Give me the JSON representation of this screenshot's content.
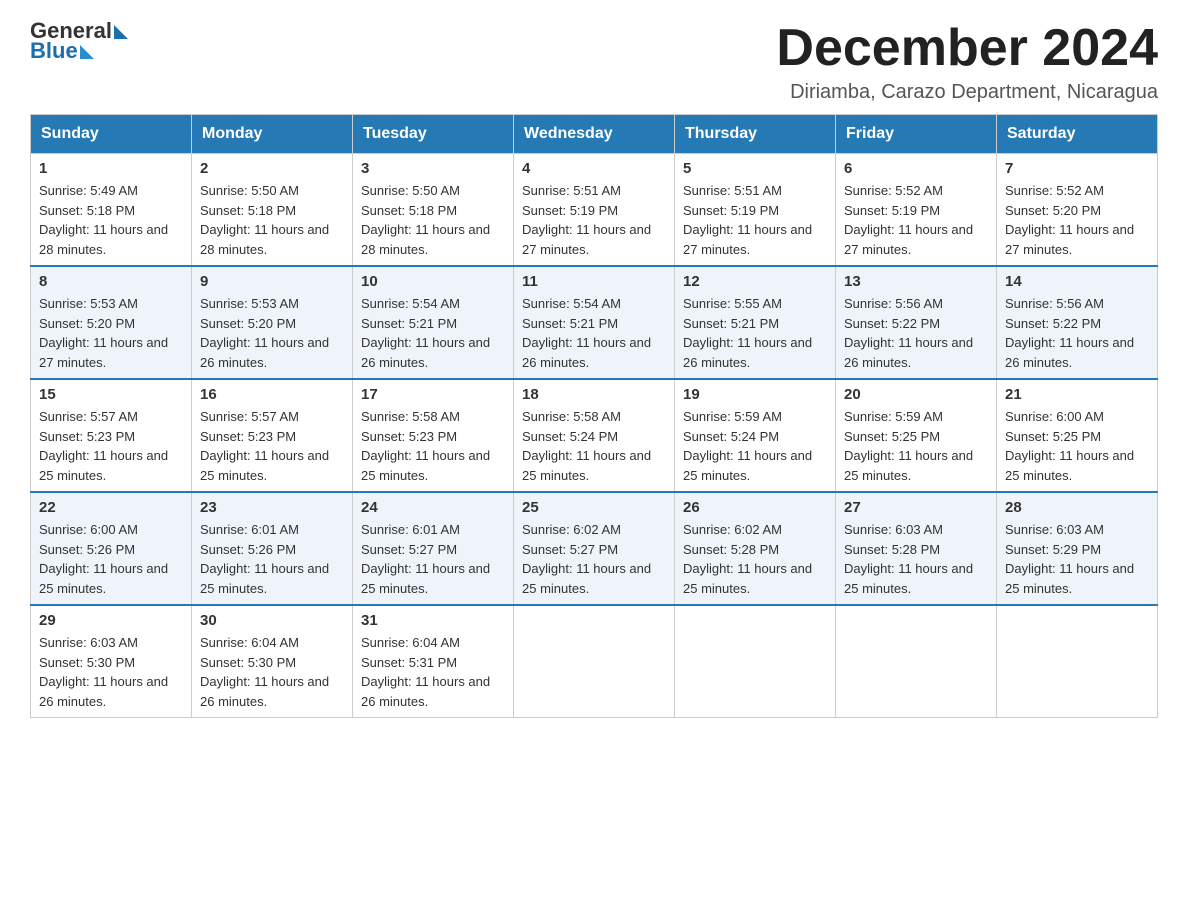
{
  "logo": {
    "text_general": "General",
    "text_blue": "Blue"
  },
  "title": "December 2024",
  "location": "Diriamba, Carazo Department, Nicaragua",
  "days_of_week": [
    "Sunday",
    "Monday",
    "Tuesday",
    "Wednesday",
    "Thursday",
    "Friday",
    "Saturday"
  ],
  "weeks": [
    [
      {
        "day": "1",
        "sunrise": "Sunrise: 5:49 AM",
        "sunset": "Sunset: 5:18 PM",
        "daylight": "Daylight: 11 hours and 28 minutes."
      },
      {
        "day": "2",
        "sunrise": "Sunrise: 5:50 AM",
        "sunset": "Sunset: 5:18 PM",
        "daylight": "Daylight: 11 hours and 28 minutes."
      },
      {
        "day": "3",
        "sunrise": "Sunrise: 5:50 AM",
        "sunset": "Sunset: 5:18 PM",
        "daylight": "Daylight: 11 hours and 28 minutes."
      },
      {
        "day": "4",
        "sunrise": "Sunrise: 5:51 AM",
        "sunset": "Sunset: 5:19 PM",
        "daylight": "Daylight: 11 hours and 27 minutes."
      },
      {
        "day": "5",
        "sunrise": "Sunrise: 5:51 AM",
        "sunset": "Sunset: 5:19 PM",
        "daylight": "Daylight: 11 hours and 27 minutes."
      },
      {
        "day": "6",
        "sunrise": "Sunrise: 5:52 AM",
        "sunset": "Sunset: 5:19 PM",
        "daylight": "Daylight: 11 hours and 27 minutes."
      },
      {
        "day": "7",
        "sunrise": "Sunrise: 5:52 AM",
        "sunset": "Sunset: 5:20 PM",
        "daylight": "Daylight: 11 hours and 27 minutes."
      }
    ],
    [
      {
        "day": "8",
        "sunrise": "Sunrise: 5:53 AM",
        "sunset": "Sunset: 5:20 PM",
        "daylight": "Daylight: 11 hours and 27 minutes."
      },
      {
        "day": "9",
        "sunrise": "Sunrise: 5:53 AM",
        "sunset": "Sunset: 5:20 PM",
        "daylight": "Daylight: 11 hours and 26 minutes."
      },
      {
        "day": "10",
        "sunrise": "Sunrise: 5:54 AM",
        "sunset": "Sunset: 5:21 PM",
        "daylight": "Daylight: 11 hours and 26 minutes."
      },
      {
        "day": "11",
        "sunrise": "Sunrise: 5:54 AM",
        "sunset": "Sunset: 5:21 PM",
        "daylight": "Daylight: 11 hours and 26 minutes."
      },
      {
        "day": "12",
        "sunrise": "Sunrise: 5:55 AM",
        "sunset": "Sunset: 5:21 PM",
        "daylight": "Daylight: 11 hours and 26 minutes."
      },
      {
        "day": "13",
        "sunrise": "Sunrise: 5:56 AM",
        "sunset": "Sunset: 5:22 PM",
        "daylight": "Daylight: 11 hours and 26 minutes."
      },
      {
        "day": "14",
        "sunrise": "Sunrise: 5:56 AM",
        "sunset": "Sunset: 5:22 PM",
        "daylight": "Daylight: 11 hours and 26 minutes."
      }
    ],
    [
      {
        "day": "15",
        "sunrise": "Sunrise: 5:57 AM",
        "sunset": "Sunset: 5:23 PM",
        "daylight": "Daylight: 11 hours and 25 minutes."
      },
      {
        "day": "16",
        "sunrise": "Sunrise: 5:57 AM",
        "sunset": "Sunset: 5:23 PM",
        "daylight": "Daylight: 11 hours and 25 minutes."
      },
      {
        "day": "17",
        "sunrise": "Sunrise: 5:58 AM",
        "sunset": "Sunset: 5:23 PM",
        "daylight": "Daylight: 11 hours and 25 minutes."
      },
      {
        "day": "18",
        "sunrise": "Sunrise: 5:58 AM",
        "sunset": "Sunset: 5:24 PM",
        "daylight": "Daylight: 11 hours and 25 minutes."
      },
      {
        "day": "19",
        "sunrise": "Sunrise: 5:59 AM",
        "sunset": "Sunset: 5:24 PM",
        "daylight": "Daylight: 11 hours and 25 minutes."
      },
      {
        "day": "20",
        "sunrise": "Sunrise: 5:59 AM",
        "sunset": "Sunset: 5:25 PM",
        "daylight": "Daylight: 11 hours and 25 minutes."
      },
      {
        "day": "21",
        "sunrise": "Sunrise: 6:00 AM",
        "sunset": "Sunset: 5:25 PM",
        "daylight": "Daylight: 11 hours and 25 minutes."
      }
    ],
    [
      {
        "day": "22",
        "sunrise": "Sunrise: 6:00 AM",
        "sunset": "Sunset: 5:26 PM",
        "daylight": "Daylight: 11 hours and 25 minutes."
      },
      {
        "day": "23",
        "sunrise": "Sunrise: 6:01 AM",
        "sunset": "Sunset: 5:26 PM",
        "daylight": "Daylight: 11 hours and 25 minutes."
      },
      {
        "day": "24",
        "sunrise": "Sunrise: 6:01 AM",
        "sunset": "Sunset: 5:27 PM",
        "daylight": "Daylight: 11 hours and 25 minutes."
      },
      {
        "day": "25",
        "sunrise": "Sunrise: 6:02 AM",
        "sunset": "Sunset: 5:27 PM",
        "daylight": "Daylight: 11 hours and 25 minutes."
      },
      {
        "day": "26",
        "sunrise": "Sunrise: 6:02 AM",
        "sunset": "Sunset: 5:28 PM",
        "daylight": "Daylight: 11 hours and 25 minutes."
      },
      {
        "day": "27",
        "sunrise": "Sunrise: 6:03 AM",
        "sunset": "Sunset: 5:28 PM",
        "daylight": "Daylight: 11 hours and 25 minutes."
      },
      {
        "day": "28",
        "sunrise": "Sunrise: 6:03 AM",
        "sunset": "Sunset: 5:29 PM",
        "daylight": "Daylight: 11 hours and 25 minutes."
      }
    ],
    [
      {
        "day": "29",
        "sunrise": "Sunrise: 6:03 AM",
        "sunset": "Sunset: 5:30 PM",
        "daylight": "Daylight: 11 hours and 26 minutes."
      },
      {
        "day": "30",
        "sunrise": "Sunrise: 6:04 AM",
        "sunset": "Sunset: 5:30 PM",
        "daylight": "Daylight: 11 hours and 26 minutes."
      },
      {
        "day": "31",
        "sunrise": "Sunrise: 6:04 AM",
        "sunset": "Sunset: 5:31 PM",
        "daylight": "Daylight: 11 hours and 26 minutes."
      },
      {
        "day": "",
        "sunrise": "",
        "sunset": "",
        "daylight": ""
      },
      {
        "day": "",
        "sunrise": "",
        "sunset": "",
        "daylight": ""
      },
      {
        "day": "",
        "sunrise": "",
        "sunset": "",
        "daylight": ""
      },
      {
        "day": "",
        "sunrise": "",
        "sunset": "",
        "daylight": ""
      }
    ]
  ]
}
